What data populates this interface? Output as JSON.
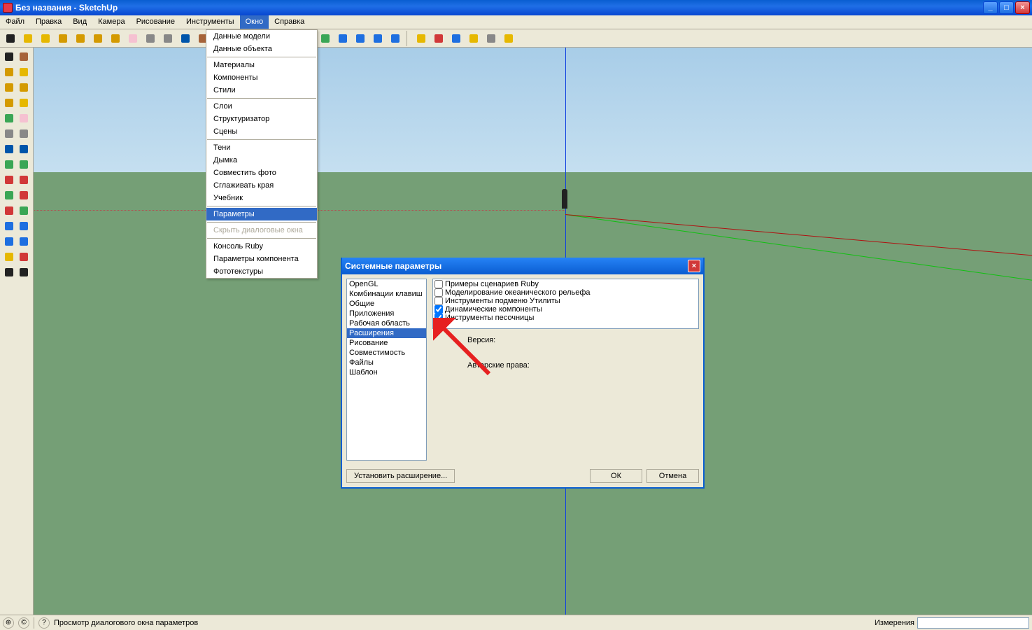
{
  "window": {
    "title": "Без названия - SketchUp"
  },
  "menubar": {
    "items": [
      "Файл",
      "Правка",
      "Вид",
      "Камера",
      "Рисование",
      "Инструменты",
      "Окно",
      "Справка"
    ],
    "open_index": 6
  },
  "dropdown": {
    "groups": [
      [
        "Данные модели",
        "Данные объекта"
      ],
      [
        "Материалы",
        "Компоненты",
        "Стили"
      ],
      [
        "Слои",
        "Структуризатор",
        "Сцены"
      ],
      [
        "Тени",
        "Дымка",
        "Совместить фото",
        "Сглаживать края",
        "Учебник"
      ],
      [
        "Параметры"
      ],
      [
        "Скрыть диалоговые окна"
      ],
      [
        "Консоль Ruby",
        "Параметры компонента",
        "Фототекстуры"
      ]
    ],
    "selected": "Параметры",
    "disabled": [
      "Скрыть диалоговые окна"
    ]
  },
  "toolbar_icons": [
    "select",
    "pencil",
    "line",
    "rect",
    "circle",
    "arc",
    "polygon",
    "eraser",
    "tape",
    "protractor",
    "text",
    "paint",
    "push",
    "move",
    "rotate",
    "scale",
    "offset",
    "orbit",
    "pan",
    "zoom",
    "zoom-ext",
    "prev",
    "next",
    "sep",
    "user",
    "mark",
    "globe",
    "layers",
    "outliner",
    "vray"
  ],
  "side_icons": [
    [
      "select",
      "paint"
    ],
    [
      "rect",
      "pencil"
    ],
    [
      "circle",
      "arc"
    ],
    [
      "polygon",
      "freehand"
    ],
    [
      "comp",
      "eraser"
    ],
    [
      "tape",
      "dim"
    ],
    [
      "text",
      "3dtext"
    ],
    [
      "push",
      "follow"
    ],
    [
      "move",
      "rotate"
    ],
    [
      "scale",
      "offset"
    ],
    [
      "orbit",
      "pan"
    ],
    [
      "zoom",
      "zoomwin"
    ],
    [
      "zoomext",
      "prevview"
    ],
    [
      "section",
      "axes"
    ],
    [
      "walk",
      "look"
    ]
  ],
  "dialog": {
    "title": "Системные параметры",
    "categories": [
      "OpenGL",
      "Комбинации клавиш",
      "Общие",
      "Приложения",
      "Рабочая область",
      "Расширения",
      "Рисование",
      "Совместимость",
      "Файлы",
      "Шаблон"
    ],
    "selected_category": "Расширения",
    "extensions": [
      {
        "label": "Примеры сценариев Ruby",
        "checked": false
      },
      {
        "label": "Моделирование океанического рельефа",
        "checked": false
      },
      {
        "label": "Инструменты подменю Утилиты",
        "checked": false
      },
      {
        "label": "Динамические компоненты",
        "checked": true
      },
      {
        "label": "Инструменты песочницы",
        "checked": true
      }
    ],
    "version_label": "Версия:",
    "copyright_label": "Авторские права:",
    "install_ext_btn": "Установить расширение...",
    "ok_btn": "ОК",
    "cancel_btn": "Отмена"
  },
  "statusbar": {
    "hint": "Просмотр диалогового окна параметров",
    "measurements_label": "Измерения"
  }
}
